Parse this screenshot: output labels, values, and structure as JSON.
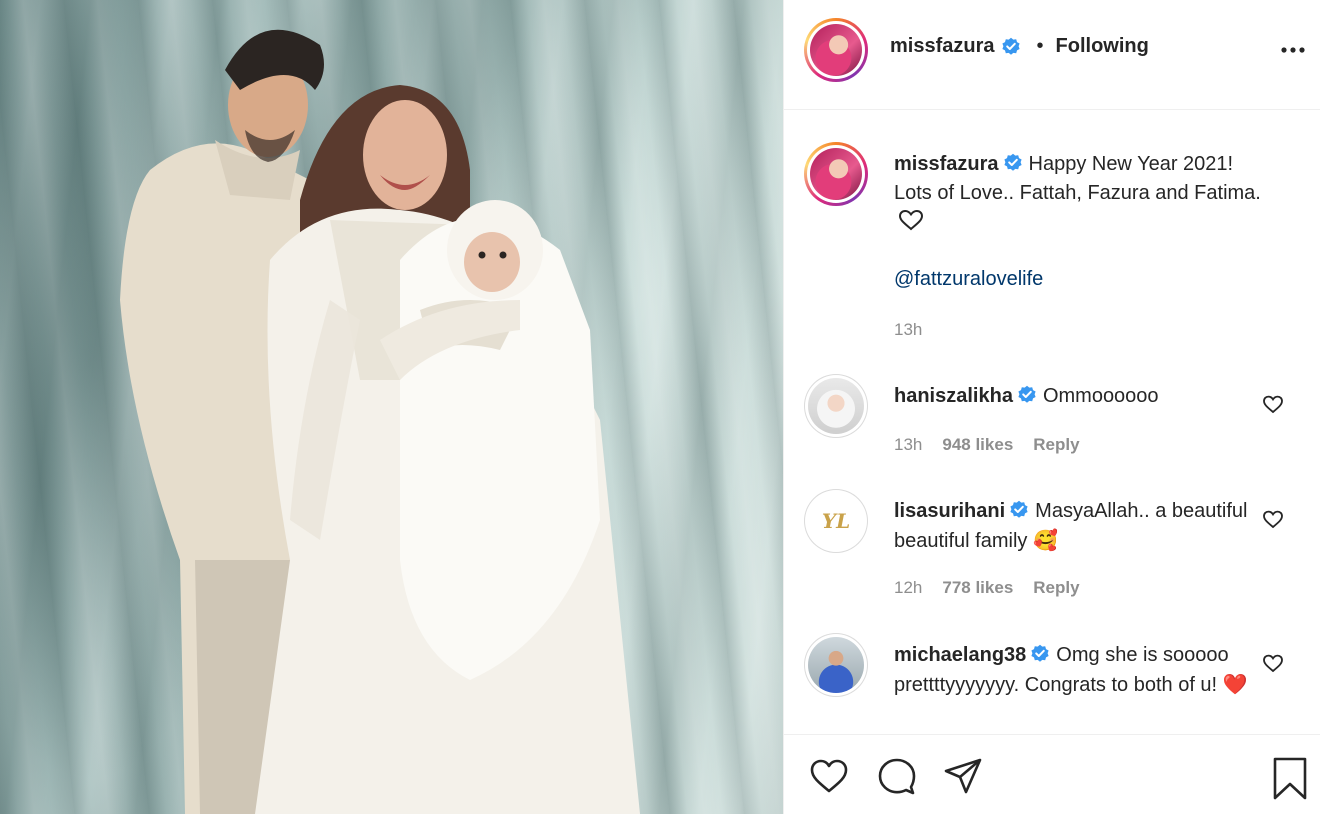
{
  "post": {
    "author": "missfazura",
    "follow_status": "Following",
    "separator": "•",
    "caption_line1": "Happy New Year 2021!",
    "caption_rest": "Lots of Love.. Fattah, Fazura and Fatima.",
    "caption_mention": "@fattzuralovelife",
    "caption_time": "13h"
  },
  "comments": [
    {
      "user": "haniszalikha",
      "text": "Ommoooooo",
      "time": "13h",
      "likes": "948 likes",
      "reply": "Reply"
    },
    {
      "user": "lisasurihani",
      "text": "MasyaAllah.. a beautiful beautiful family",
      "emoji": "🥰",
      "time": "12h",
      "likes": "778 likes",
      "reply": "Reply",
      "avatar_text": "YL"
    },
    {
      "user": "michaelang38",
      "text": "Omg she is sooooo prettttyyyyyyy. Congrats to both of u!",
      "emoji": "❤️"
    }
  ],
  "colors": {
    "verified": "#3897f0",
    "link": "#00376b",
    "muted": "#8e8e8e",
    "heart_red": "#ed4956"
  },
  "icons": [
    "more-icon",
    "verified-icon",
    "heart-outline-icon",
    "heart-icon",
    "comment-icon",
    "share-icon",
    "bookmark-icon",
    "smiling-face-hearts-emoji",
    "red-heart-emoji"
  ]
}
